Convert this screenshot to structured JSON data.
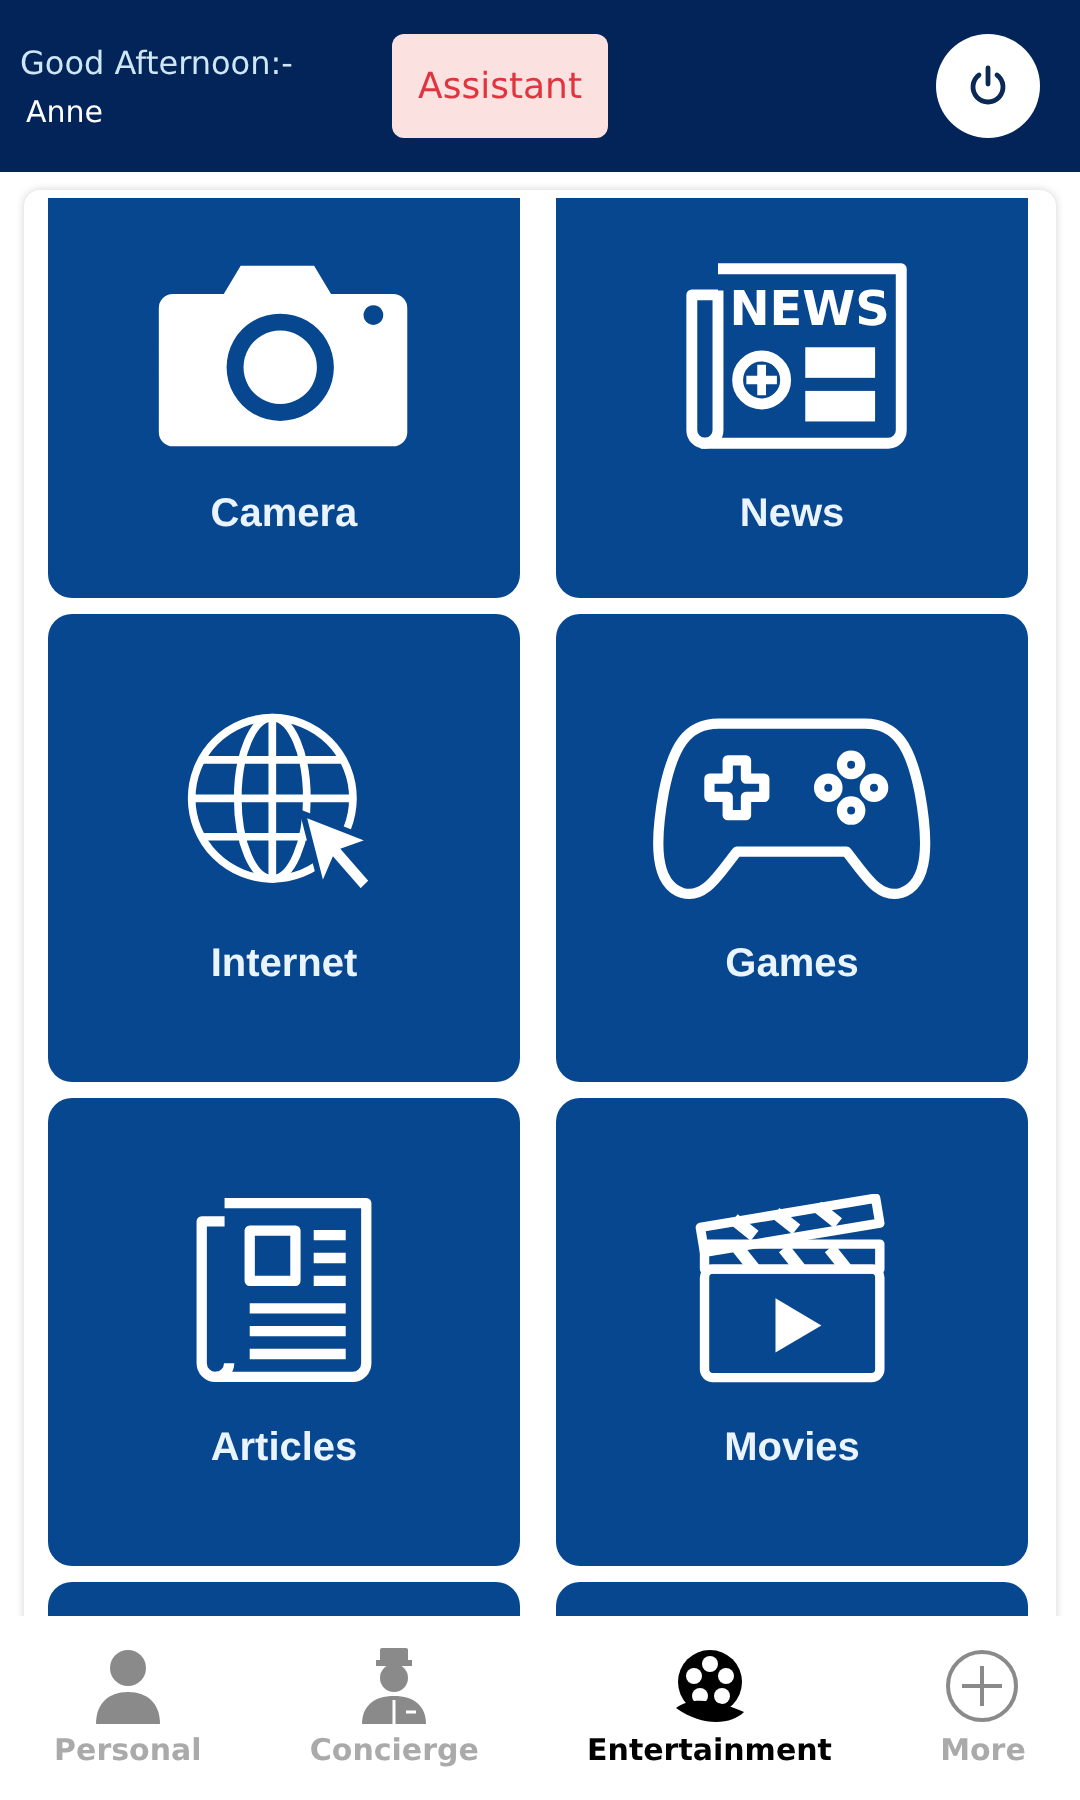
{
  "header": {
    "greeting": "Good Afternoon:-",
    "name": "Anne",
    "assistant_button": "Assistant"
  },
  "tiles": [
    {
      "kind": "camera",
      "label": "Camera"
    },
    {
      "kind": "news",
      "label": "News"
    },
    {
      "kind": "internet",
      "label": "Internet"
    },
    {
      "kind": "games",
      "label": "Games"
    },
    {
      "kind": "articles",
      "label": "Articles"
    },
    {
      "kind": "movies",
      "label": "Movies"
    },
    {
      "kind": "partial"
    },
    {
      "kind": "partial"
    }
  ],
  "nav": [
    {
      "kind": "person",
      "label": "Personal",
      "selected": false
    },
    {
      "kind": "concierge",
      "label": "Concierge",
      "selected": false
    },
    {
      "kind": "film",
      "label": "Entertainment",
      "selected": true
    },
    {
      "kind": "plus",
      "label": "More",
      "selected": false
    }
  ],
  "news_icon": {
    "text": "NEWS"
  }
}
